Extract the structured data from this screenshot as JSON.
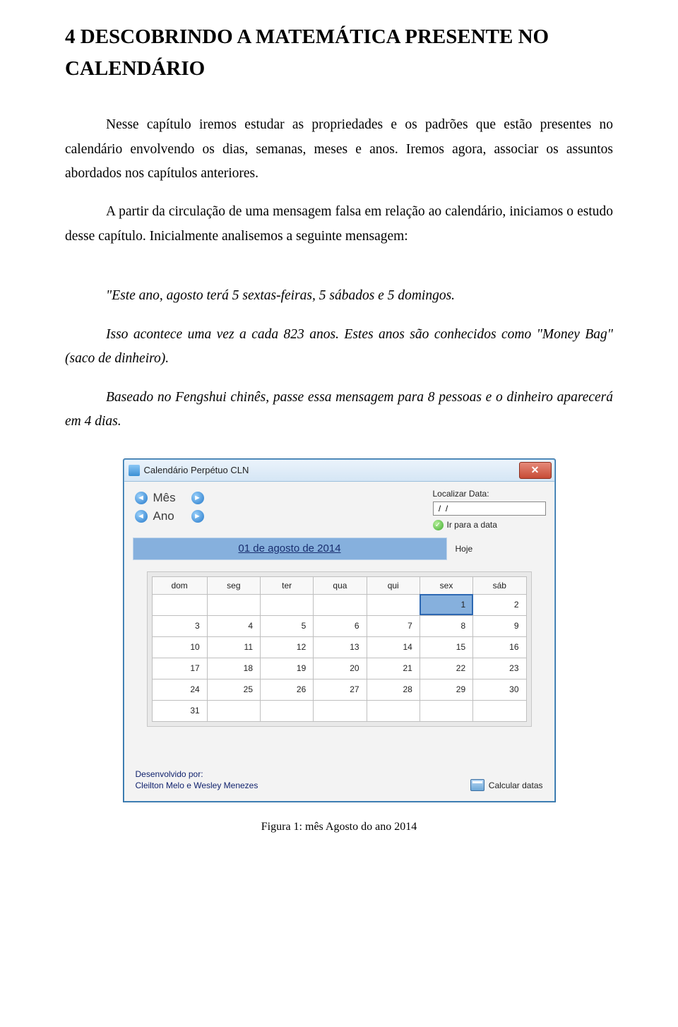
{
  "title": "4 DESCOBRINDO A MATEMÁTICA PRESENTE NO CALENDÁRIO",
  "para1": "Nesse capítulo iremos estudar as propriedades e os padrões que estão presentes no calendário envolvendo os dias, semanas, meses e anos. Iremos agora, associar os assuntos abordados nos capítulos anteriores.",
  "para2": "A partir da circulação de uma mensagem falsa em relação ao calendário, iniciamos o estudo desse capítulo. Inicialmente analisemos a seguinte mensagem:",
  "quote1": "\"Este ano, agosto terá 5 sextas-feiras, 5 sábados e 5 domingos.",
  "quote2": "Isso acontece uma vez a cada 823 anos. Estes anos são conhecidos como \"Money Bag\" (saco de dinheiro).",
  "quote3": "Baseado no Fengshui chinês, passe essa mensagem para 8 pessoas e o dinheiro aparecerá em 4 dias.",
  "app": {
    "window_title": "Calendário Perpétuo CLN",
    "close_glyph": "✕",
    "nav_month_label": "Mês",
    "nav_year_label": "Ano",
    "find_label": "Localizar Data:",
    "date_value": " /  /",
    "goto_label": "Ir para a data",
    "banner_date": "01 de agosto de 2014",
    "today_label": "Hoje",
    "week_headers": [
      "dom",
      "seg",
      "ter",
      "qua",
      "qui",
      "sex",
      "sáb"
    ],
    "grid": [
      [
        "",
        "",
        "",
        "",
        "",
        "1",
        "2"
      ],
      [
        "3",
        "4",
        "5",
        "6",
        "7",
        "8",
        "9"
      ],
      [
        "10",
        "11",
        "12",
        "13",
        "14",
        "15",
        "16"
      ],
      [
        "17",
        "18",
        "19",
        "20",
        "21",
        "22",
        "23"
      ],
      [
        "24",
        "25",
        "26",
        "27",
        "28",
        "29",
        "30"
      ],
      [
        "31",
        "",
        "",
        "",
        "",
        "",
        ""
      ]
    ],
    "selected_day": "1",
    "dev_line1": "Desenvolvido por:",
    "dev_line2": "Cleilton Melo e Wesley Menezes",
    "calc_label": "Calcular datas"
  },
  "caption": "Figura 1: mês Agosto do ano 2014"
}
